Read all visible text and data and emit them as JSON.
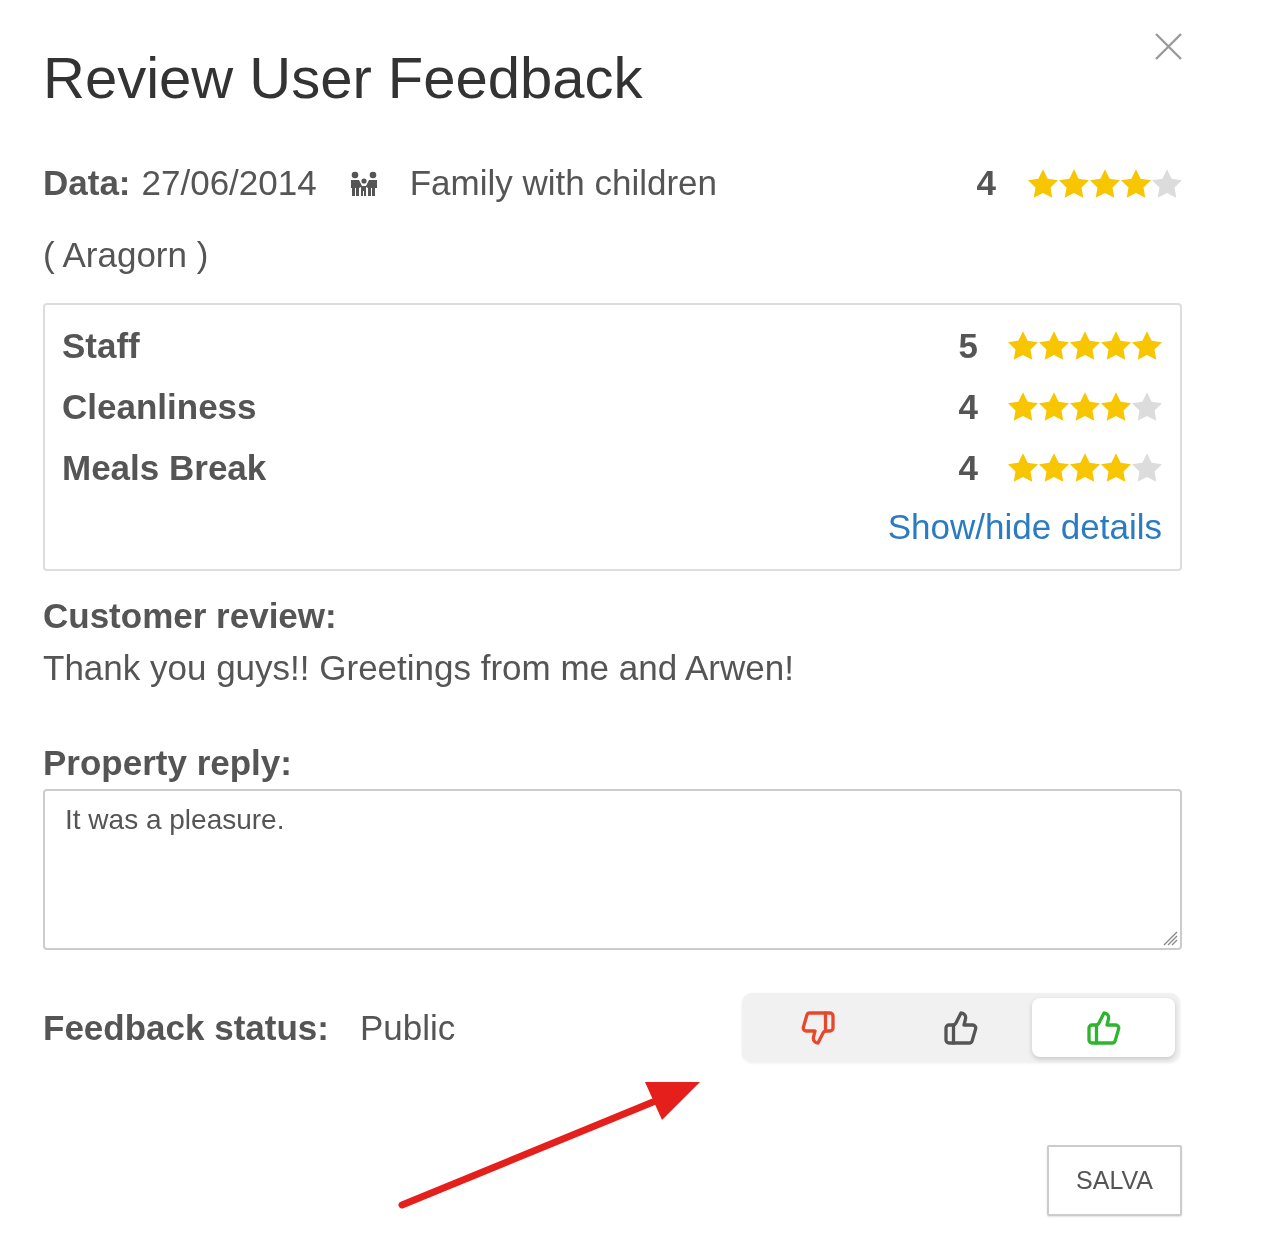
{
  "dialog": {
    "title": "Review User Feedback"
  },
  "summary": {
    "date_label": "Data:",
    "date": "27/06/2014",
    "traveller_type": "Family with children",
    "score": "4",
    "stars": 4,
    "author": "( Aragorn )"
  },
  "categories": [
    {
      "name": "Staff",
      "score": "5",
      "stars": 5
    },
    {
      "name": "Cleanliness",
      "score": "4",
      "stars": 4
    },
    {
      "name": "Meals Break",
      "score": "4",
      "stars": 4
    }
  ],
  "details_link": "Show/hide details",
  "customer_review": {
    "label": "Customer review:",
    "text": "Thank you guys!! Greetings from me and Arwen!"
  },
  "property_reply": {
    "label": "Property reply:",
    "value": "It was a pleasure."
  },
  "feedback_status": {
    "label": "Feedback status:",
    "value": "Public",
    "options": [
      {
        "kind": "negative",
        "selected": false
      },
      {
        "kind": "neutral",
        "selected": false
      },
      {
        "kind": "positive",
        "selected": true
      }
    ]
  },
  "buttons": [
    {
      "label": "SALVA"
    }
  ]
}
